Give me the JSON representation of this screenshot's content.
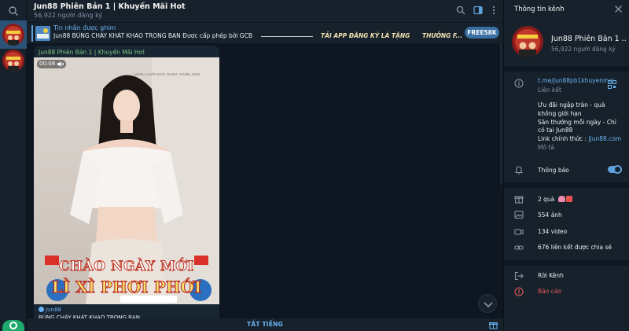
{
  "header": {
    "title": "Jun88 Phiên Bản 1 | Khuyến Mãi Hot",
    "subscribers": "56,922 người đăng ký"
  },
  "pinned": {
    "label": "Tin nhắn được ghim",
    "text": "Jun88 BÙNG CHÁY KHÁT KHAO TRONG BẠN Được cấp phép bởi GCB",
    "promo1": "TẢI APP ĐĂNG KÝ LÀ TẶNG",
    "promo2": "THƯỞNG F...",
    "button": "FREE58K"
  },
  "message": {
    "author": "Jun88 Phiên Bản 1 | Khuyến Mãi Hot",
    "duration": "00:08",
    "video_line1": "CHÀO NGÀY MỚI",
    "video_line2": "LÌ XÌ PHƠI PHỚI",
    "video_caption": "BÙNG CHÁY KHÁT KHAO TRONG BẠN",
    "forward_from": "Jun88",
    "text": "BÙNG CHÁY KHÁT KHAO TRONG BẠN"
  },
  "bottom": {
    "mute_label": "TẮT TIẾNG"
  },
  "panel": {
    "title": "Thông tin kênh",
    "channel_name": "Jun88 Phiên Bản 1 ...",
    "subscribers": "56,922 người đăng ký",
    "link": "t.me/Jun88pb1khuyenmai",
    "link_label": "Liên kết",
    "desc_line1": "Ưu đãi ngập tràn - quà không giới hạn",
    "desc_line2": "Săn thưởng mỗi ngày - Chỉ có tại Jun88",
    "desc_line3_prefix": "Link chính thức : ",
    "desc_line3_link": "Jjun88.com",
    "desc_label": "Mô tả",
    "notifications": "Thông báo",
    "gifts": "2 quà",
    "photos": "554 ảnh",
    "videos": "134 video",
    "links": "676 liên kết được chia sẻ",
    "leave": "Rời Kênh",
    "report": "Báo cáo"
  },
  "colors": {
    "accent": "#6ab3f3",
    "danger": "#e5585b",
    "background": "#0e1621",
    "panel": "#17212b"
  }
}
